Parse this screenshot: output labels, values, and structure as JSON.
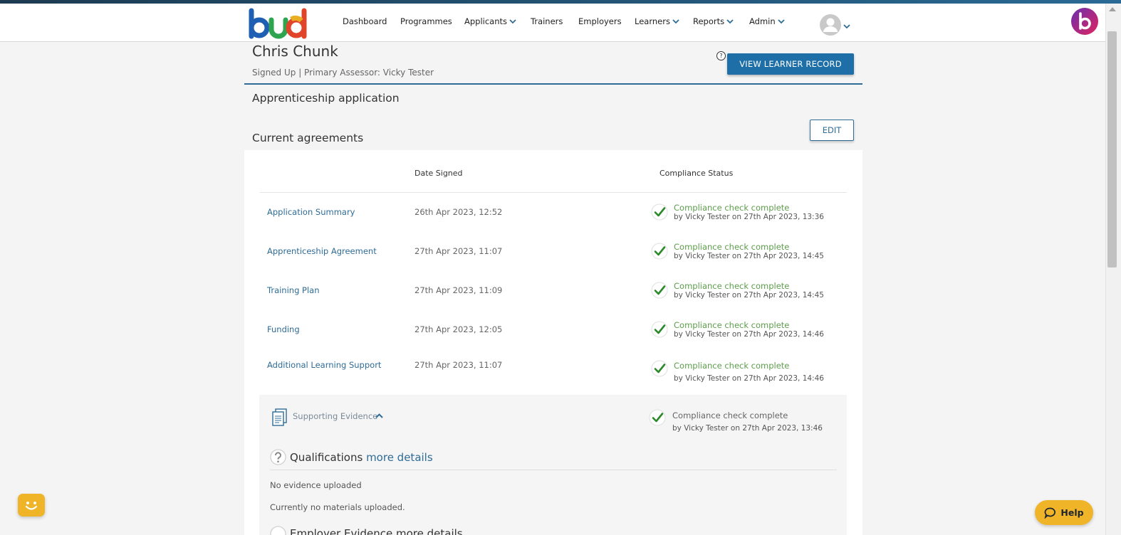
{
  "nav": {
    "brand": "bud",
    "items": [
      {
        "label": "Dashboard",
        "dropdown": false
      },
      {
        "label": "Programmes",
        "dropdown": false
      },
      {
        "label": "Applicants",
        "dropdown": true
      },
      {
        "label": "Trainers",
        "dropdown": false
      },
      {
        "label": "Employers",
        "dropdown": false
      },
      {
        "label": "Learners",
        "dropdown": true
      },
      {
        "label": "Reports",
        "dropdown": true
      },
      {
        "label": "Admin",
        "dropdown": true
      }
    ]
  },
  "learner": {
    "name": "Chris Chunk",
    "meta": "Signed Up  | Primary Assessor: Vicky Tester",
    "help": "?",
    "view_record_label": "VIEW LEARNER RECORD"
  },
  "application": {
    "title": "Apprenticeship application",
    "agreements_title": "Current agreements",
    "edit_label": "EDIT",
    "columns": [
      "Date Signed",
      "Compliance Status"
    ],
    "rows": [
      {
        "name": "Application Summary",
        "date": "26th Apr 2023, 12:52",
        "status": "Compliance check complete",
        "by": "by Vicky Tester on 27th Apr 2023, 13:36"
      },
      {
        "name": "Apprenticeship Agreement",
        "date": "27th Apr 2023, 11:07",
        "status": "Compliance check complete",
        "by": "by Vicky Tester on 27th Apr 2023, 14:45"
      },
      {
        "name": "Training Plan",
        "date": "27th Apr 2023, 11:09",
        "status": "Compliance check complete",
        "by": "by Vicky Tester on 27th Apr 2023, 14:45"
      },
      {
        "name": "Funding",
        "date": "27th Apr 2023, 12:05",
        "status": "Compliance check complete",
        "by": "by Vicky Tester on 27th Apr 2023, 14:46"
      },
      {
        "name": "Additional Learning Support",
        "date": "27th Apr 2023, 11:07",
        "status": "Compliance check complete",
        "by": "by Vicky Tester on 27th Apr 2023, 14:46"
      }
    ]
  },
  "evidence": {
    "label": "Supporting Evidence",
    "status": "Compliance check complete",
    "by": "by Vicky Tester on 27th Apr 2023, 13:46",
    "qualifications_title": "Qualifications",
    "more_details": "more details",
    "no_evidence": "No evidence uploaded",
    "no_materials": "Currently no materials uploaded.",
    "next_section_partial": "Employer Evidence more details"
  },
  "widgets": {
    "help_label": "Help"
  },
  "icons": {
    "check": "check-circle-icon",
    "document": "document-icon",
    "question": "question-circle-icon",
    "chevron": "chevron-down-icon",
    "avatar": "user-avatar-icon",
    "chat": "chat-bubble-icon"
  },
  "colors": {
    "accent": "#1e6fa8",
    "link": "#2e6c97",
    "success": "#5d9e4c",
    "check_green": "#2a8a2a",
    "help_widget": "#f0b429"
  }
}
